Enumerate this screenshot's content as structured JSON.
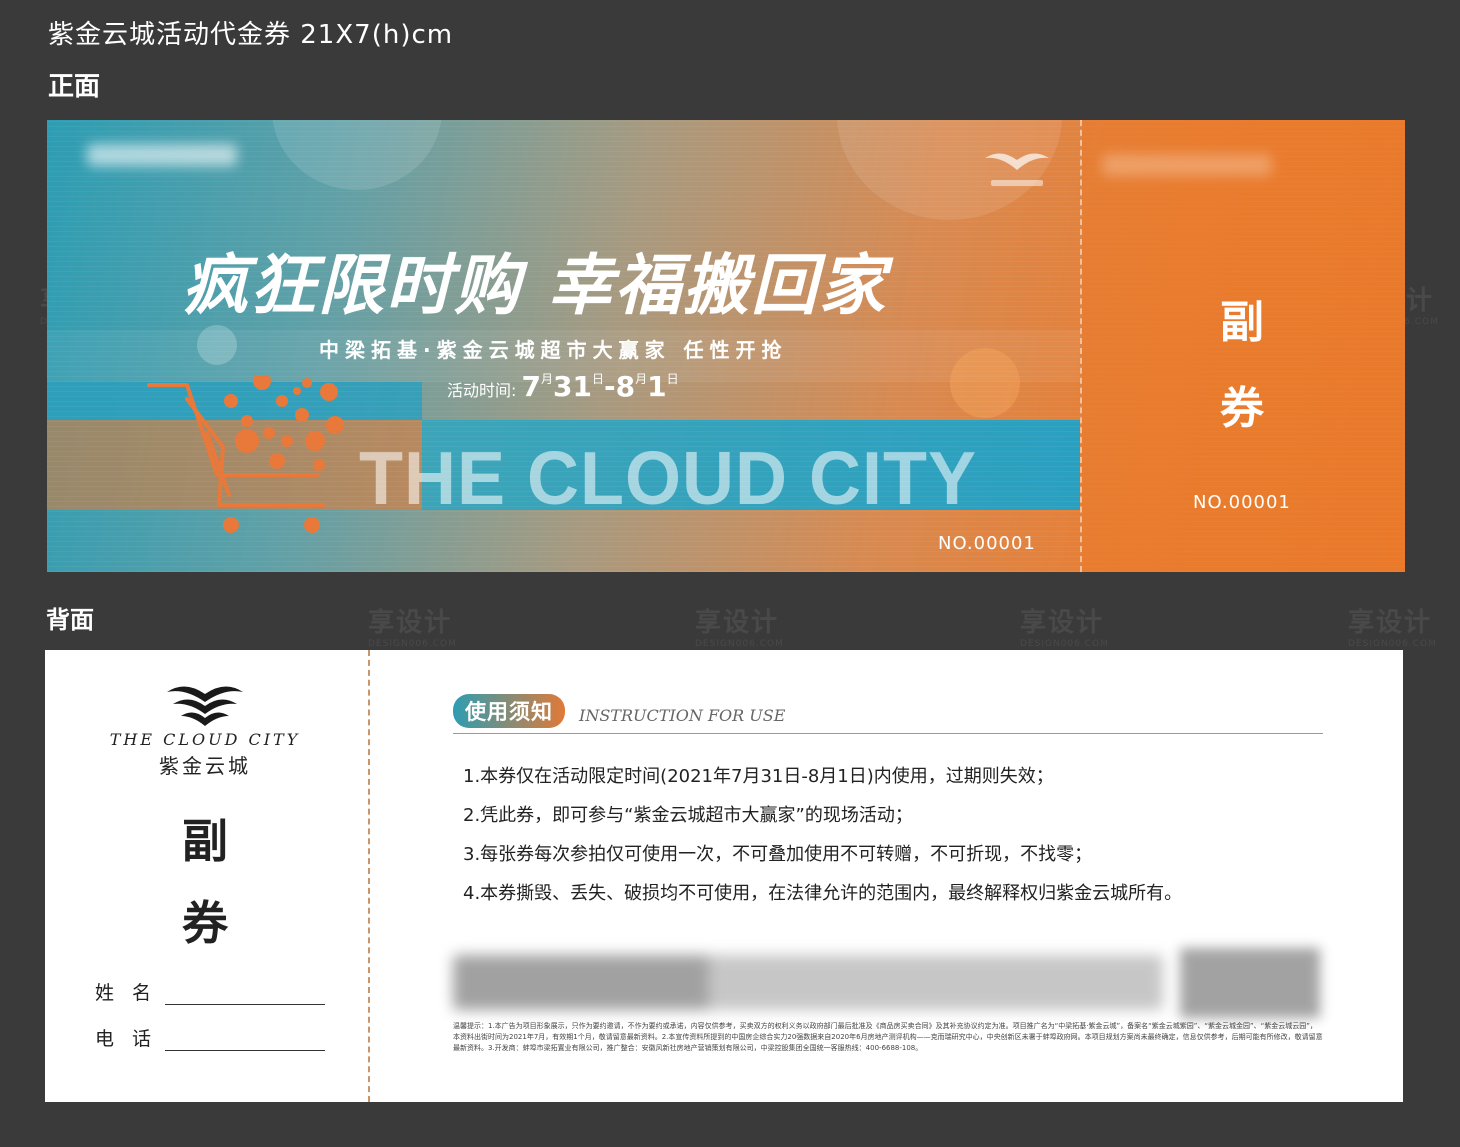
{
  "header": {
    "title": "紫金云城活动代金券    21X7(h)cm",
    "front_label": "正面",
    "back_label": "背面"
  },
  "watermark": {
    "text": "享设计",
    "sub": "DESIGN006.COM"
  },
  "front": {
    "headline": "疯狂限时购 幸福搬回家",
    "subtitle": "中梁拓基·紫金云城超市大赢家  任性开抢",
    "date_label": "活动时间:",
    "date_value_parts": [
      "7",
      "月",
      "31",
      "日",
      "-8",
      "月",
      "1",
      "日"
    ],
    "english_title": "THE CLOUD CITY",
    "serial": "NO.00001",
    "stub_title": "副券",
    "stub_serial": "NO.00001",
    "colors": {
      "teal": "#2d9db3",
      "orange": "#ea7a2c"
    }
  },
  "back": {
    "brand_en": "THE CLOUD CITY",
    "brand_cn": "紫金云城",
    "stub_title": "副券",
    "fields": [
      {
        "label": "姓 名"
      },
      {
        "label": "电 话"
      }
    ],
    "instructions_title": "使用须知",
    "instructions_title_en": "INSTRUCTION FOR USE",
    "rules": [
      "1.本券仅在活动限定时间(2021年7月31日-8月1日)内使用，过期则失效；",
      "2.凭此券，即可参与“紫金云城超市大赢家”的现场活动；",
      "3.每张券每次参拍仅可使用一次，不可叠加使用不可转赠，不可折现，不找零；",
      "4.本券撕毁、丢失、破损均不可使用，在法律允许的范围内，最终解释权归紫金云城所有。"
    ],
    "disclaimer": "温馨提示：1.本广告为项目形象展示，只作为要约邀请，不作为要约或承诺，内容仅供参考，买卖双方的权利义务以政府部门最后批准及《商品房买卖合同》及其补充协议约定为准。项目推广名为“中梁拓基·紫金云城”，备案名“紫金云城紫园”、“紫金云城金园”、“紫金云城云园”，本资料出街时间为2021年7月，有效期1个月，敬请留意最新资料。2.本宣传资料所提到的中国房企综合实力20强数据来自2020年6月房地产测评机构——克而瑞研究中心，中央创新区未署于蚌埠政府网。本项目规划方案尚未最终确定，信息仅供参考，后期可能有所修改，敬请留意最新资料。3.开发商：蚌埠市梁拓置业有限公司，推广整合：安徽风新社房地产营销策划有限公司，中梁控股集团全国统一客服热线：400-6688-108。"
  }
}
